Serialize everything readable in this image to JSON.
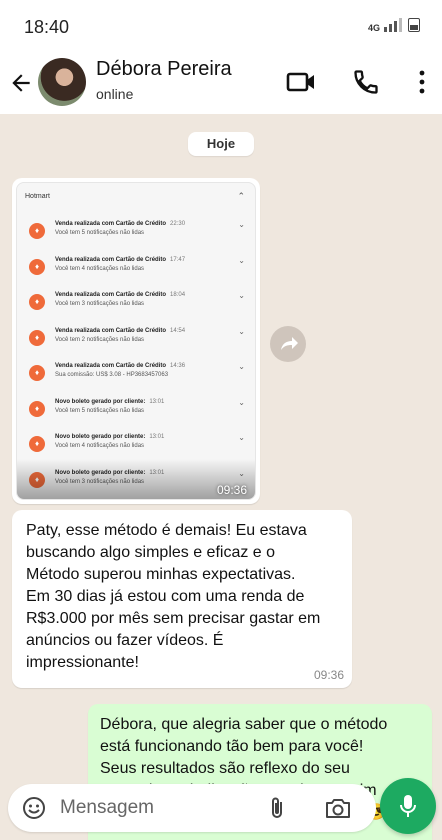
{
  "status_bar": {
    "time": "18:40",
    "network": "4G"
  },
  "header": {
    "contact_name": "Débora Pereira",
    "contact_status": "online",
    "icons": [
      "back-arrow-icon",
      "video-call-icon",
      "phone-icon",
      "more-vertical-icon"
    ]
  },
  "chat": {
    "date_chip": "Hoje",
    "image_message": {
      "time": "09:36",
      "app_name": "Hotmart",
      "notifications": [
        {
          "title": "Venda realizada com Cartão de Crédito",
          "time": "22:30",
          "subtitle": "Você tem 5 notificações não lidas"
        },
        {
          "title": "Venda realizada com Cartão de Crédito",
          "time": "17:47",
          "subtitle": "Você tem 4 notificações não lidas"
        },
        {
          "title": "Venda realizada com Cartão de Crédito",
          "time": "18:04",
          "subtitle": "Você tem 3 notificações não lidas"
        },
        {
          "title": "Venda realizada com Cartão de Crédito",
          "time": "14:54",
          "subtitle": "Você tem 2 notificações não lidas"
        },
        {
          "title": "Venda realizada com Cartão de Crédito",
          "time": "14:36",
          "subtitle": "Sua comissão: US$ 3.08 - HP3683457063"
        },
        {
          "title": "Novo boleto gerado por cliente:",
          "time": "13:01",
          "subtitle": "Você tem 5 notificações não lidas"
        },
        {
          "title": "Novo boleto gerado por cliente:",
          "time": "13:01",
          "subtitle": "Você tem 4 notificações não lidas"
        },
        {
          "title": "Novo boleto gerado por cliente:",
          "time": "13:01",
          "subtitle": "Você tem 3 notificações não lidas"
        }
      ]
    },
    "incoming_message": {
      "text": "Paty, esse método é demais! Eu estava\nbuscando algo simples e eficaz e o\nMétodo superou minhas expectativas.\nEm 30 dias já estou com uma renda de\nR$3.000 por mês sem precisar gastar em\nanúncios ou fazer vídeos. É\nimpressionante!",
      "time": "09:36"
    },
    "outgoing_message": {
      "text": "Débora, que alegria saber que o método\nestá funcionando tão bem para você!\nSeus resultados são reflexo do seu\nempenho e dedicação. Continue assim\ne logo estará atingindo novas metas! 😎"
    }
  },
  "composer": {
    "placeholder": "Mensagem"
  },
  "colors": {
    "chat_background": "#efe7de",
    "outgoing_bubble": "#d9fdd3",
    "accent_green": "#1daa61",
    "notification_orange": "#ef6a3a"
  }
}
